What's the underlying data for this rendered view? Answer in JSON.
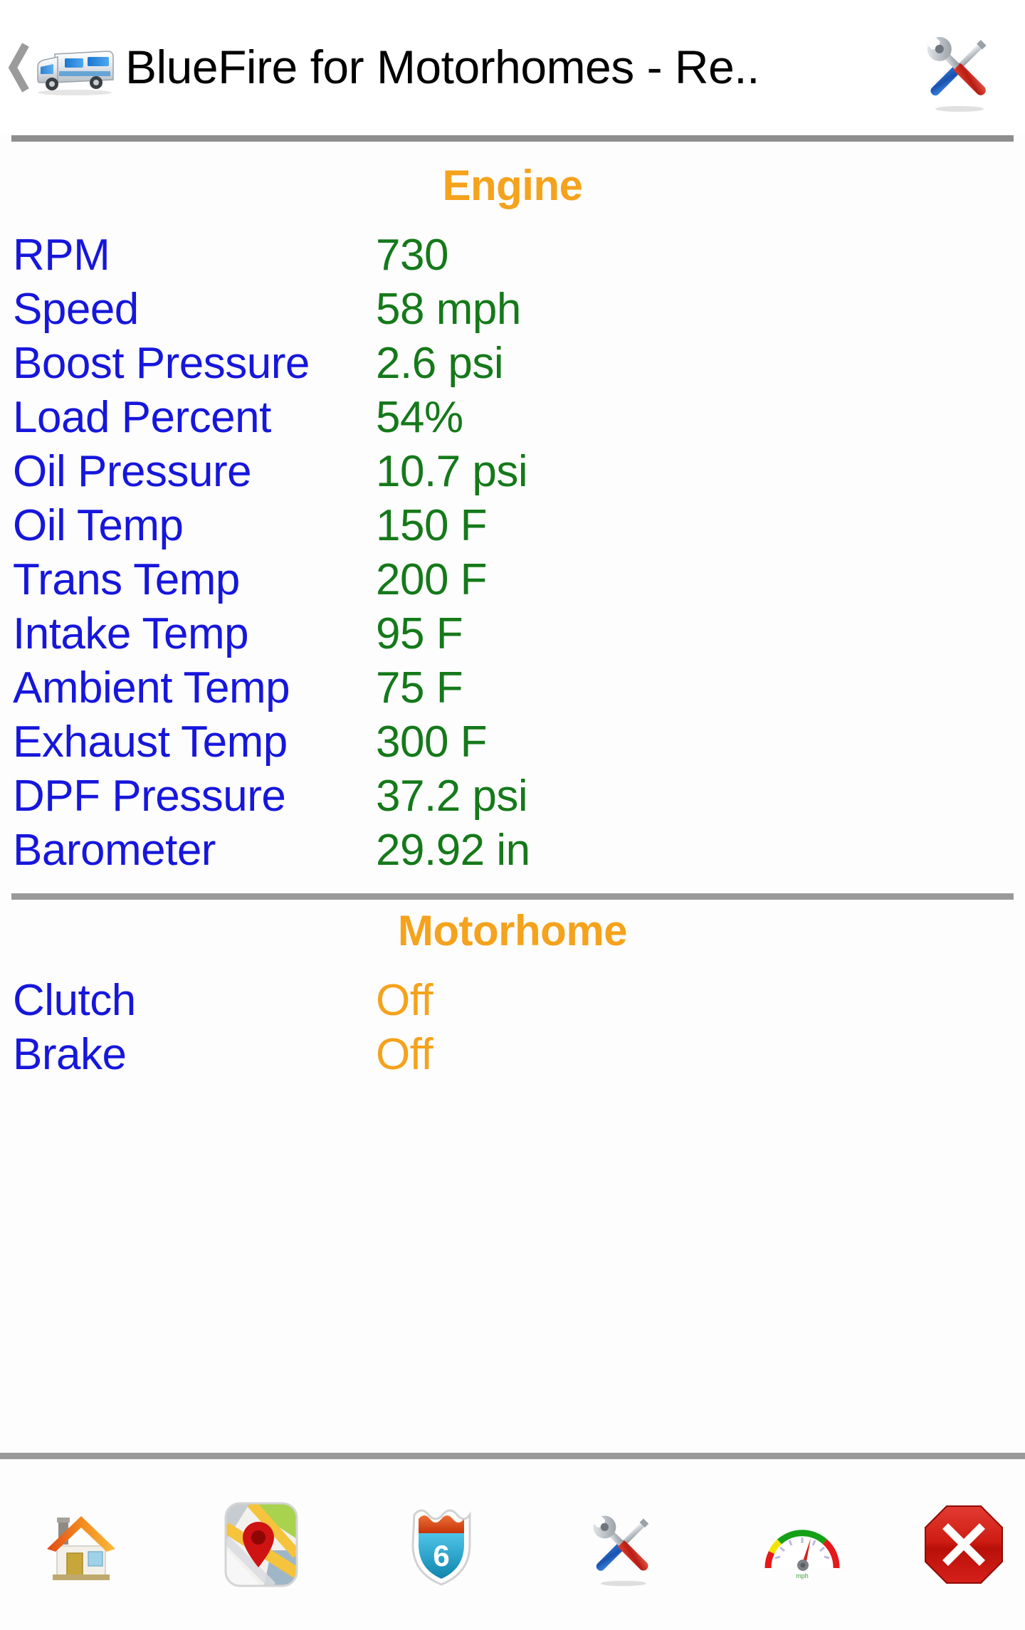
{
  "header": {
    "back_icon": "chevron-left-icon",
    "app_icon": "motorhome-icon",
    "title": "BlueFire for Motorhomes - Re..",
    "action_icon": "tools-icon"
  },
  "colors": {
    "section_title": "#f5a21c",
    "label": "#1616dc",
    "value": "#15791a",
    "state_value": "#f5a21c",
    "rule": "#9a9a9a",
    "background": "#fdfdfd"
  },
  "sections": [
    {
      "title": "Engine",
      "rows": [
        {
          "label": "RPM",
          "value": "730"
        },
        {
          "label": "Speed",
          "value": "58 mph"
        },
        {
          "label": "Boost Pressure",
          "value": "2.6 psi"
        },
        {
          "label": "Load Percent",
          "value": "54%"
        },
        {
          "label": "Oil Pressure",
          "value": "10.7 psi"
        },
        {
          "label": "Oil Temp",
          "value": "150 F"
        },
        {
          "label": "Trans Temp",
          "value": "200 F"
        },
        {
          "label": "Intake Temp",
          "value": "95 F"
        },
        {
          "label": "Ambient Temp",
          "value": "75 F"
        },
        {
          "label": "Exhaust Temp",
          "value": "300 F"
        },
        {
          "label": "DPF Pressure",
          "value": "37.2 psi"
        },
        {
          "label": "Barometer",
          "value": "29.92 in"
        }
      ]
    },
    {
      "title": "Motorhome",
      "rows": [
        {
          "label": "Clutch",
          "value": "Off",
          "state": true
        },
        {
          "label": "Brake",
          "value": "Off",
          "state": true
        }
      ]
    }
  ],
  "tabbar": {
    "items": [
      {
        "icon": "home-icon",
        "name": "tab-home"
      },
      {
        "icon": "map-icon",
        "name": "tab-map"
      },
      {
        "icon": "highway-shield-icon",
        "name": "tab-highway",
        "shield_number": "6"
      },
      {
        "icon": "tools-icon",
        "name": "tab-tools"
      },
      {
        "icon": "gauge-icon",
        "name": "tab-gauges"
      },
      {
        "icon": "stop-icon",
        "name": "tab-disconnect"
      }
    ]
  }
}
